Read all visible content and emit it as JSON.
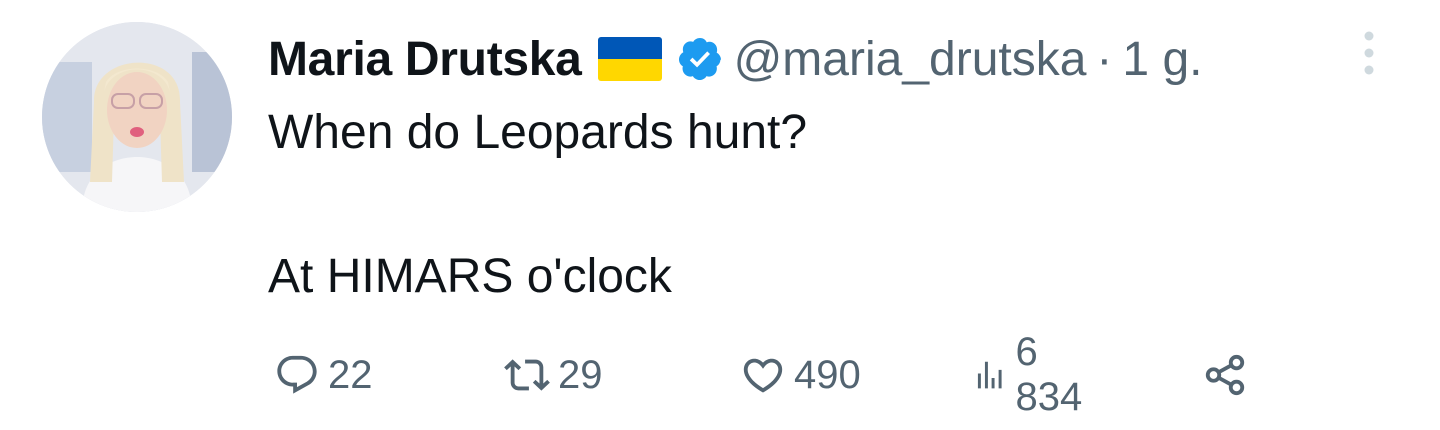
{
  "tweet": {
    "author": {
      "display_name": "Maria Drutska",
      "flag_icon": "ukraine-flag-icon",
      "verified_icon": "verified-badge-icon",
      "handle": "@maria_drutska",
      "separator": "·",
      "time": "1 g."
    },
    "text": {
      "line1": "When do Leopards hunt?",
      "line2": "At HIMARS o'clock"
    },
    "actions": {
      "replies": "22",
      "retweets": "29",
      "likes": "490",
      "views": "6 834"
    }
  },
  "colors": {
    "text_primary": "#0f1419",
    "text_secondary": "#536471",
    "verified_blue": "#1d9bf0",
    "flag_blue": "#0057b7",
    "flag_yellow": "#ffd700"
  }
}
